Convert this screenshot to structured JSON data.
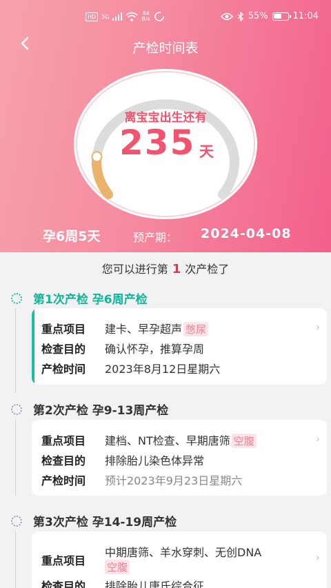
{
  "status_bar": {
    "hd": "HD",
    "network": "5G",
    "speed_value": "84",
    "speed_unit": "B/s",
    "battery": "55%",
    "time": "11:04"
  },
  "header": {
    "title": "产检时间表",
    "countdown_label": "离宝宝出生还有",
    "days_left": "235",
    "days_unit": "天",
    "progress_fraction": 0.15,
    "pregnancy_week": "孕6周5天",
    "due_label": "预产期：",
    "due_date": "2024-04-08"
  },
  "notice": {
    "prefix": "您可以进行第",
    "number": "1",
    "suffix": "次产检了"
  },
  "exams": [
    {
      "title": "第1次产检  孕6周产检",
      "items_label": "重点项目",
      "items": "建卡、早孕超声",
      "tag": "憋尿",
      "purpose_label": "检查目的",
      "purpose": "确认怀孕，推算孕周",
      "time_label": "产检时间",
      "time": "2023年8月12日星期六"
    },
    {
      "title": "第2次产检  孕9-13周产检",
      "items_label": "重点项目",
      "items": "建档、NT检查、早期唐筛",
      "tag": "空腹",
      "purpose_label": "检查目的",
      "purpose": "排除胎儿染色体异常",
      "time_label": "产检时间",
      "time": "预计2023年9月23日星期六"
    },
    {
      "title": "第3次产检  孕14-19周产检",
      "items_label": "重点项目",
      "items": "中期唐筛、羊水穿刺、无创DNA",
      "tag": "空腹",
      "purpose_label": "检查目的",
      "purpose": "排除胎儿唐氏综合征"
    }
  ],
  "colors": {
    "accent_pink": "#f0546e",
    "header_start": "#f7a3ab",
    "header_end": "#f3608b",
    "active_green": "#16c0a1",
    "progress_orange": "#e9b36c",
    "tag_bg": "#fde5e7"
  }
}
